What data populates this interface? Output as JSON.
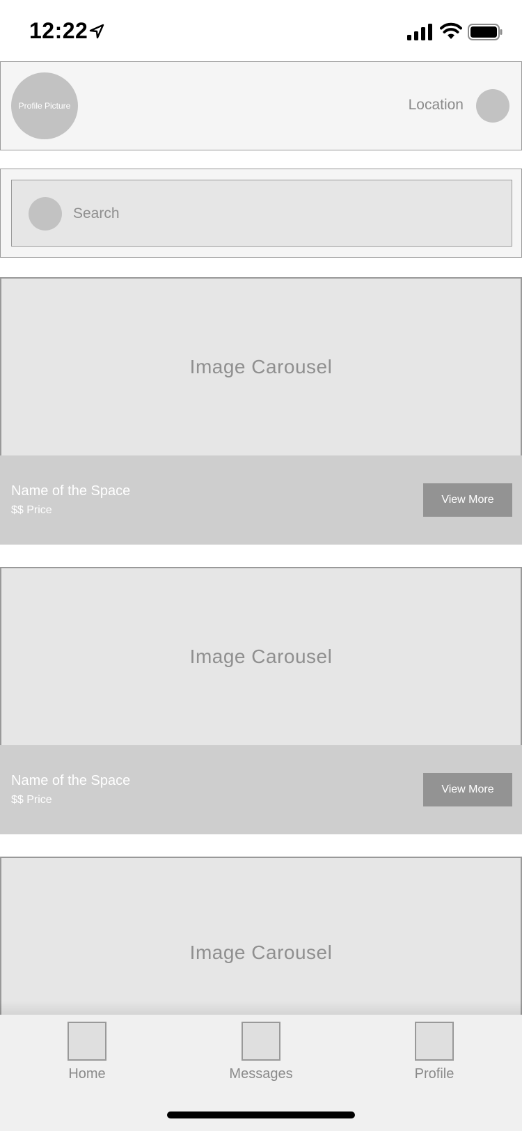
{
  "status_bar": {
    "time": "12:22"
  },
  "header": {
    "profile_picture_label": "Profile Picture",
    "location_label": "Location"
  },
  "search": {
    "placeholder": "Search"
  },
  "cards": [
    {
      "carousel_label": "Image Carousel",
      "name": "Name of the Space",
      "price": "$$ Price",
      "button_label": "View More"
    },
    {
      "carousel_label": "Image Carousel",
      "name": "Name of the Space",
      "price": "$$ Price",
      "button_label": "View More"
    },
    {
      "carousel_label": "Image Carousel"
    }
  ],
  "tab_bar": {
    "items": [
      {
        "label": "Home",
        "icon": "home-icon"
      },
      {
        "label": "Messages",
        "icon": "messages-icon"
      },
      {
        "label": "Profile",
        "icon": "profile-icon"
      }
    ]
  },
  "colors": {
    "placeholder_fill": "#e6e6e6",
    "info_bar": "#cecece",
    "button": "#939393",
    "muted_text": "#8a8a8a"
  }
}
